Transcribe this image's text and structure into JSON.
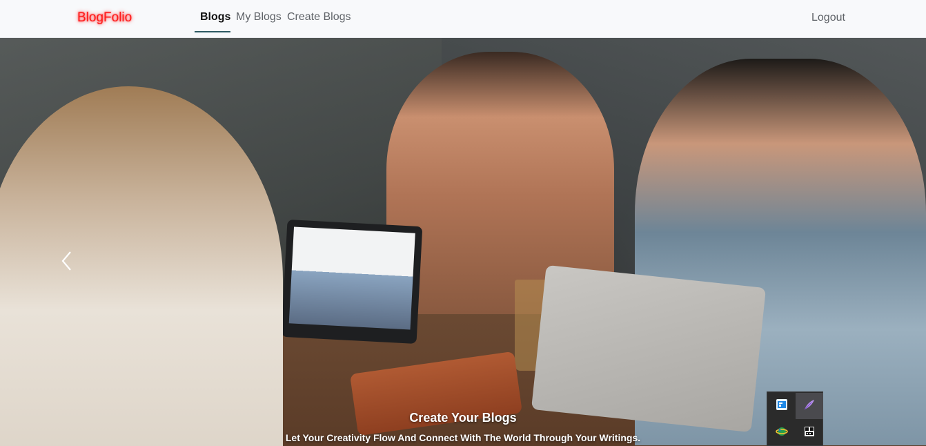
{
  "navbar": {
    "brand": "BlogFolio",
    "links": [
      {
        "label": "Blogs",
        "active": true
      },
      {
        "label": "My Blogs",
        "active": false
      },
      {
        "label": "Create Blogs",
        "active": false
      }
    ],
    "logout": "Logout"
  },
  "hero": {
    "caption_title": "Create Your Blogs",
    "caption_subtitle": "Let Your Creativity Flow And Connect With The World Through Your Writings.",
    "prev_icon": "chevron-left-icon"
  },
  "tray": {
    "icons": [
      "window-app-icon",
      "feather-icon",
      "network-globe-icon",
      "terminal-app-icon"
    ]
  },
  "colors": {
    "brand": "#ff1a1a",
    "nav_background": "#f8f9fb",
    "active_underline": "#2d5a63"
  }
}
